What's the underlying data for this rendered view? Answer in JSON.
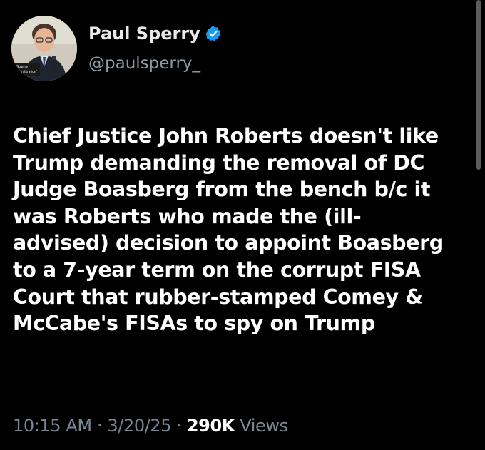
{
  "author": {
    "name": "Paul Sperry",
    "handle": "@paulsperry_",
    "verified": true,
    "avatar_icon": "portrait-avatar",
    "avatar_caption_line1": "l Sperry",
    "avatar_caption_line2": "or, \"Infiltration\""
  },
  "tweet": {
    "lines": [
      "Chief Justice John Roberts doesn't like",
      "Trump demanding the removal of DC",
      "Judge Boasberg from the bench b/c it",
      "was Roberts who made the (ill-",
      "advised) decision to appoint Boasberg",
      "to a 7-year term on the corrupt FISA",
      "Court that rubber-stamped Comey &",
      "McCabe's FISAs to spy on Trump"
    ]
  },
  "meta": {
    "time": "10:15 AM",
    "separator": "·",
    "date": "3/20/25",
    "views_count": "290K",
    "views_label": "Views"
  },
  "colors": {
    "background": "#000000",
    "text": "#ffffff",
    "secondary": "#8b98a5",
    "verified": "#1d9bf0"
  }
}
